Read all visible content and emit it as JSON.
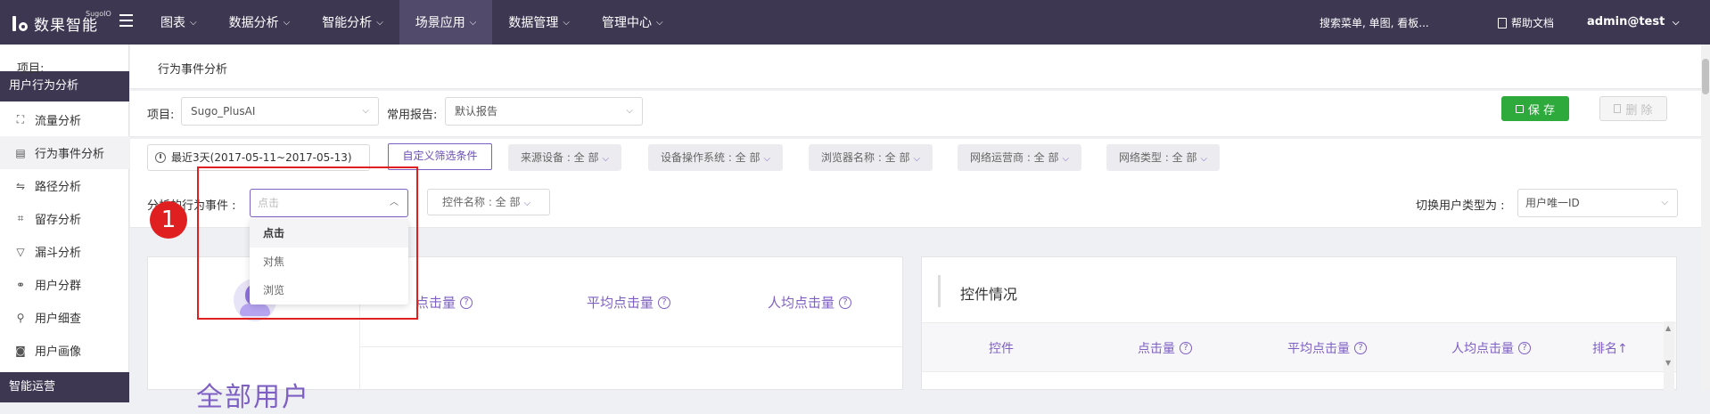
{
  "topbar": {
    "logo_text": "数果智能",
    "logo_sup": "SugoIO",
    "nav": [
      {
        "label": "图表",
        "active": false
      },
      {
        "label": "数据分析",
        "active": false
      },
      {
        "label": "智能分析",
        "active": false
      },
      {
        "label": "场景应用",
        "active": true
      },
      {
        "label": "数据管理",
        "active": false
      },
      {
        "label": "管理中心",
        "active": false
      }
    ],
    "search_text": "搜索菜单, 单图, 看板...",
    "help_label": "帮助文档",
    "user_label": "admin@test"
  },
  "sidebar": {
    "section1_title": "用户行为分析",
    "items": [
      {
        "label": "流量分析",
        "icon": "流"
      },
      {
        "label": "行为事件分析",
        "icon": "▤"
      },
      {
        "label": "路径分析",
        "icon": "⇋"
      },
      {
        "label": "留存分析",
        "icon": "⌗"
      },
      {
        "label": "漏斗分析",
        "icon": "▽"
      },
      {
        "label": "用户分群",
        "icon": "⚭"
      },
      {
        "label": "用户细查",
        "icon": "⚲"
      },
      {
        "label": "用户画像",
        "icon": "◙"
      }
    ],
    "section2_title": "智能运营"
  },
  "page": {
    "breadcrumb": "行为事件分析",
    "project_label": "项目:",
    "project_value": "Sugo_PlusAI",
    "report_label": "常用报告:",
    "report_value": "默认报告",
    "save_label": "保 存",
    "delete_label": "删 除"
  },
  "filters": {
    "date_range": "最近3天(2017-05-11~2017-05-13)",
    "custom_filter": "自定义筛选条件",
    "pills": [
      "来源设备 : 全 部",
      "设备操作系统 : 全 部",
      "浏览器名称 : 全 部",
      "网络运营商 : 全 部",
      "网络类型 : 全 部"
    ]
  },
  "event": {
    "label": "分析的行为事件 :",
    "placeholder": "点击",
    "options": [
      "点击",
      "对焦",
      "浏览"
    ],
    "control_filter": "控件名称 : 全 部",
    "switch_label": "切换用户类型为 :",
    "user_type": "用户唯一ID"
  },
  "annotation": {
    "badge": "1"
  },
  "summary_card": {
    "metrics": [
      "点击量",
      "平均点击量",
      "人均点击量"
    ],
    "big_text": "全部用户"
  },
  "control_card": {
    "title": "控件情况",
    "columns": [
      "控件",
      "点击量",
      "平均点击量",
      "人均点击量",
      "排名↑"
    ]
  },
  "colors": {
    "topbar": "#3d3751",
    "accent": "#7e5fc3",
    "save_button": "#2ea93c",
    "highlight": "#e02020"
  }
}
